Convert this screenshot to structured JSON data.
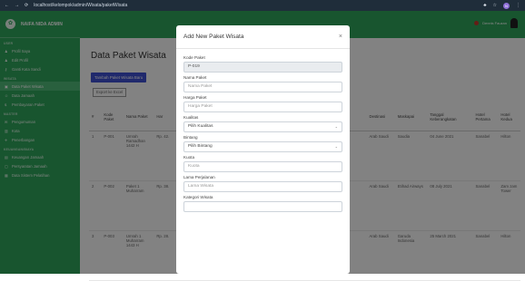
{
  "browser": {
    "url": "localhost/kelompok/admin/Wisata/paketWisata",
    "profile_initial": "N"
  },
  "sidebar": {
    "brand": "NAIFA NIDA ADMIN",
    "sections": {
      "user": "USER",
      "wisata": "WISATA",
      "master": "MASTER",
      "keuangan": "KEUANGAN/BIAYA"
    },
    "items": {
      "profil": "Profil Saya",
      "edit": "Edit Profil",
      "ganti": "Ganti Kata Sandi",
      "paket": "Data Paket Wisata",
      "jamaah": "Data Jamaah",
      "pembayaran": "Pembayaran Paket",
      "pengumuman": "Pengumuman",
      "kota": "Kota",
      "penerbangan": "Penerbangan",
      "keuangan_item": "Keuangan Jamaah",
      "persyaratan": "Persyaratan Jamaah",
      "data_sistem": "Data Sistem Pelatihan"
    }
  },
  "topbar": {
    "user_name": "Dennis Fauzan"
  },
  "main": {
    "title": "Data Paket Wisata",
    "add_button": "Tambah Paket Wisata Baru",
    "export_button": "Export ke Excel",
    "columns": [
      "#",
      "Kode Paket",
      "Nama Paket",
      "Har",
      "",
      "",
      "",
      "Destinasi",
      "Maskapai",
      "Tanggal Keberangkatan",
      "Hotel Pertama",
      "Hotel Kedua"
    ],
    "rows": [
      {
        "no": "1",
        "kode": "P-001",
        "nama": "Umrah Ramadhan 1442 H",
        "harga": "Rp. 42.",
        "destinasi": "Arab Saudi",
        "maskapai": "Saudia",
        "tanggal": "04 June 2021",
        "hotel1": "Sanabel",
        "hotel2": "Hilton"
      },
      {
        "no": "2",
        "kode": "P-002",
        "nama": "Paket 1 Muharram",
        "harga": "Rp. 38.",
        "destinasi": "Arab Saudi",
        "maskapai": "Etihad Airways",
        "tanggal": "08 July 2021",
        "hotel1": "Sanabel",
        "hotel2": "Zam zam Tower"
      },
      {
        "no": "3",
        "kode": "P-003",
        "nama": "Umrah 1 Muharram 1443 H",
        "harga": "Rp. 28.",
        "destinasi": "Arab Saudi",
        "maskapai": "Garuda Indonesia",
        "tanggal": "25 March 2021",
        "hotel1": "Sanabel",
        "hotel2": "Hilton"
      }
    ]
  },
  "modal": {
    "title": "Add New Paket Wisata",
    "close": "×",
    "fields": {
      "kode_label": "Kode Paket",
      "kode_value": "P-019",
      "nama_label": "Nama Paket",
      "nama_placeholder": "Nama Paket",
      "harga_label": "Harga Paket",
      "harga_placeholder": "Harga Paket",
      "kualitas_label": "Kualitas",
      "kualitas_value": "Pilih Kualitas",
      "bintang_label": "Bintang",
      "bintang_value": "Pilih Bintang",
      "kuota_label": "Kuota",
      "kuota_placeholder": "Kuota",
      "lama_label": "Lama Perjalanan",
      "lama_placeholder": "Lama Wisata",
      "kategori_label": "Kategori Wisata"
    }
  }
}
